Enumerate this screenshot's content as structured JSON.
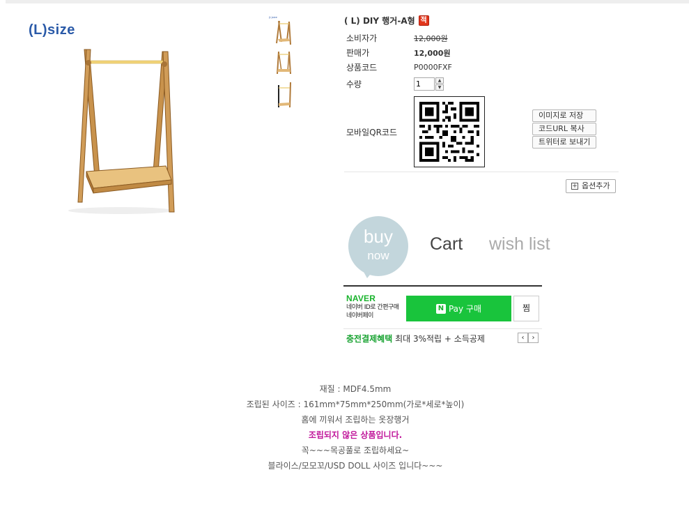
{
  "main_image": {
    "size_label": "(L)size"
  },
  "thumbnails": [
    {
      "label": "(L)size"
    },
    {
      "label": ""
    },
    {
      "label": ""
    }
  ],
  "product": {
    "title": "( L) DIY 행거-A형",
    "badge": "적",
    "fields": {
      "consumer_price_label": "소비자가",
      "consumer_price": "12,000원",
      "sale_price_label": "판매가",
      "sale_price": "12,000원",
      "code_label": "상품코드",
      "code": "P0000FXF",
      "qty_label": "수량",
      "qty_value": "1",
      "qr_label": "모바일QR코드"
    },
    "qr_actions": [
      "이미지로 저장",
      "코드URL 복사",
      "트위터로 보내기"
    ],
    "option_add": "옵션추가"
  },
  "buttons": {
    "buy": "buy",
    "now": "now",
    "cart": "Cart",
    "wish": "wish list"
  },
  "naver_pay": {
    "logo": "NAVER",
    "desc_line1": "네이버 ID로 간편구매",
    "desc_line2": "네이버페이",
    "pay_n": "N",
    "pay_label": "Pay 구매",
    "jjim": "찜",
    "benefit_green": "충전결제혜택",
    "benefit_text": "최대 3%적립 + 소득공제",
    "prev": "‹",
    "next": "›"
  },
  "description": [
    {
      "text": "재질 :  MDF4.5mm",
      "strong": false
    },
    {
      "text": "조립된 사이즈 : 161mm*75mm*250mm(가로*세로*높이)",
      "strong": false
    },
    {
      "text": "홈에 끼워서 조립하는 옷장행거",
      "strong": false
    },
    {
      "text": "조립되지 않은 상품입니다.",
      "strong": true
    },
    {
      "text": "꼭~~~목공풀로 조립하세요~",
      "strong": false
    },
    {
      "text": "블라이스/모모꼬/USD DOLL 사이즈 입니다~~~",
      "strong": false
    }
  ],
  "colors": {
    "sale_price": "#1f77c4",
    "naver_green": "#19c43c",
    "bubble": "#c3d6dc",
    "emphasis": "#c0169a",
    "badge": "#e2361b"
  }
}
